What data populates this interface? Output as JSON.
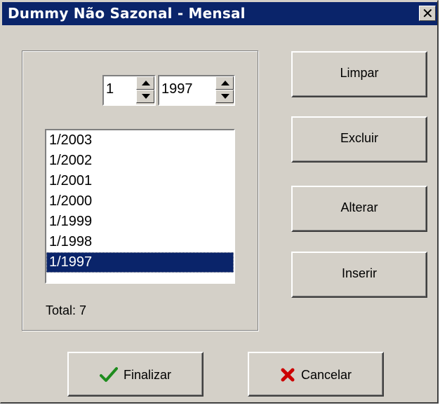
{
  "window": {
    "title": "Dummy Não Sazonal - Mensal"
  },
  "spinners": {
    "month": "1",
    "year": "1997"
  },
  "list": {
    "items": [
      "1/2003",
      "1/2002",
      "1/2001",
      "1/2000",
      "1/1999",
      "1/1998",
      "1/1997"
    ],
    "selected": "1/1997"
  },
  "total_label": "Total: 7",
  "buttons": {
    "limpar": "Limpar",
    "excluir": "Excluir",
    "alterar": "Alterar",
    "inserir": "Inserir",
    "finalizar": "Finalizar",
    "cancelar": "Cancelar"
  },
  "colors": {
    "titlebar": "#0a246a",
    "face": "#d4d0c8",
    "check": "#1e8c1e",
    "cross": "#cc0000"
  }
}
